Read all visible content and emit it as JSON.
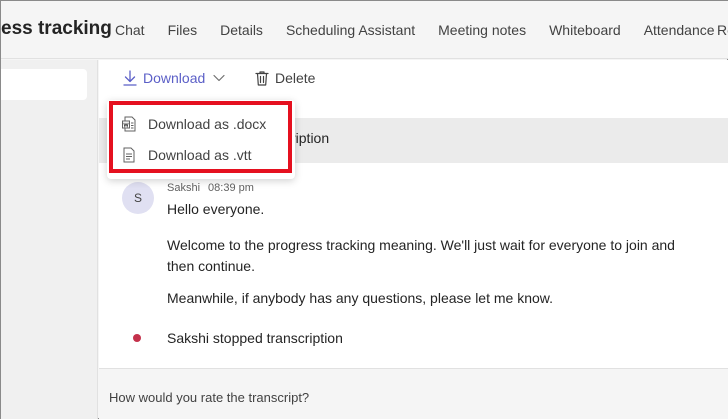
{
  "header": {
    "title": "ess tracking",
    "tabs": [
      {
        "label": "Chat"
      },
      {
        "label": "Files"
      },
      {
        "label": "Details"
      },
      {
        "label": "Scheduling Assistant"
      },
      {
        "label": "Meeting notes"
      },
      {
        "label": "Whiteboard"
      },
      {
        "label": "Attendance"
      }
    ],
    "clipped_tab": "Re"
  },
  "toolbar": {
    "download_label": "Download",
    "delete_label": "Delete"
  },
  "dropdown": {
    "items": [
      {
        "label": "Download as .docx",
        "icon": "word-doc-icon"
      },
      {
        "label": "Download as .vtt",
        "icon": "text-file-icon"
      }
    ]
  },
  "transcript": {
    "banner_text": "ription",
    "speaker": "Sakshi",
    "time": "08:39 pm",
    "avatar_initial": "S",
    "messages": [
      "Hello everyone.",
      "Welcome to the progress tracking meaning. We'll just wait for everyone to join and then continue.",
      "Meanwhile, if anybody has any questions, please let me know."
    ],
    "event": "Sakshi stopped transcription"
  },
  "rating": {
    "prompt": "How would you rate the transcript?"
  },
  "colors": {
    "accent": "#5b5fc7",
    "highlight": "#e5101f",
    "event_dot": "#c4314b"
  }
}
